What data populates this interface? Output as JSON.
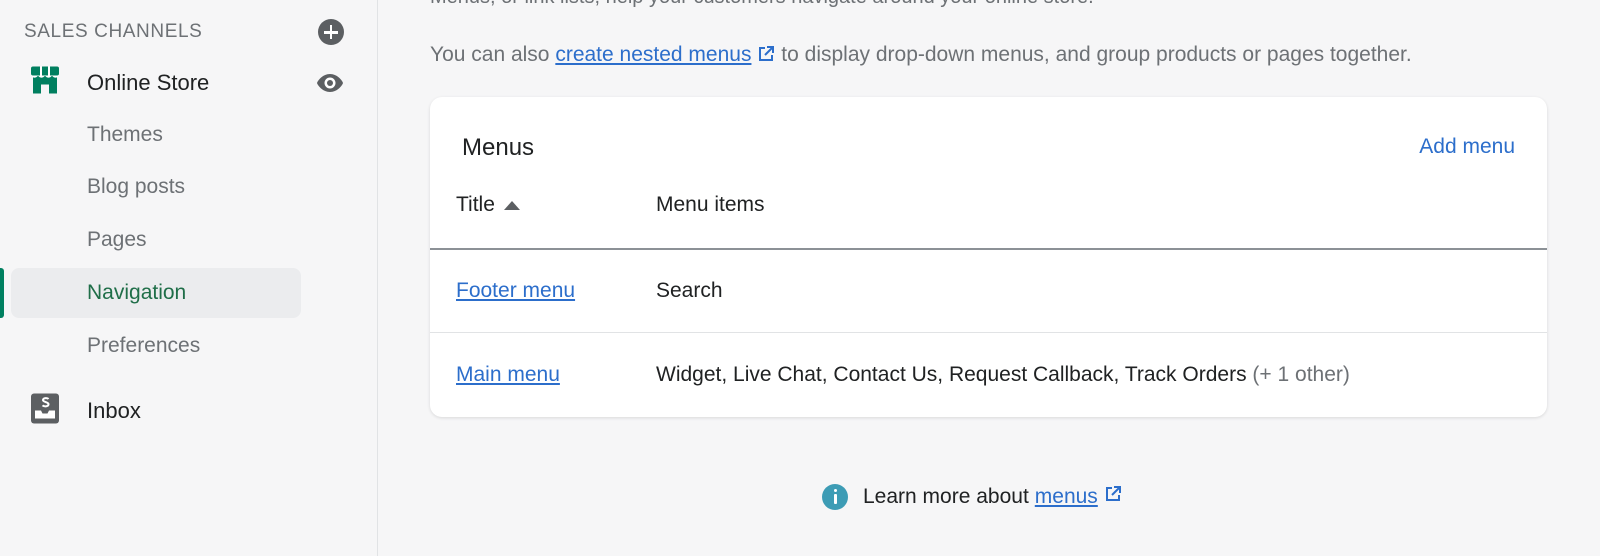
{
  "sidebar": {
    "section_title": "SALES CHANNELS",
    "online_store": {
      "label": "Online Store"
    },
    "sub_items": [
      {
        "label": "Themes"
      },
      {
        "label": "Blog posts"
      },
      {
        "label": "Pages"
      },
      {
        "label": "Navigation",
        "active": true
      },
      {
        "label": "Preferences"
      }
    ],
    "inbox": {
      "label": "Inbox"
    },
    "colors": {
      "active_text": "#1f6e48",
      "active_bar": "#008060",
      "store_icon": "#007f5f"
    }
  },
  "main": {
    "intro_cut": "Menus, or link lists, help your customers navigate around your online store.",
    "intro": {
      "prefix": "You can also ",
      "link": "create nested menus",
      "suffix": " to display drop-down menus, and group products or pages together."
    },
    "card": {
      "title": "Menus",
      "add_menu_label": "Add menu",
      "columns": {
        "title": "Title",
        "items": "Menu items"
      },
      "rows": [
        {
          "title": "Footer menu",
          "items": "Search",
          "extra": ""
        },
        {
          "title": "Main menu",
          "items": "Widget, Live Chat, Contact Us, Request Callback, Track Orders",
          "extra": "(+ 1 other)"
        }
      ]
    },
    "learn_more": {
      "prefix": "Learn more about ",
      "link": "menus"
    },
    "colors": {
      "link": "#2c6ecb",
      "info_icon": "#3d9cb5"
    }
  }
}
